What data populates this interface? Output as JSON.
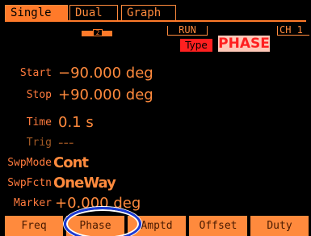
{
  "tabs": {
    "single": "Single",
    "dual": "Dual",
    "graph": "Graph"
  },
  "status": {
    "channel_indicator": "2",
    "run": "RUN",
    "channel": "CH 1",
    "type_label": "Type",
    "type_value": "PHASE"
  },
  "params": {
    "start": {
      "label": "Start",
      "value": "−90.000 deg"
    },
    "stop": {
      "label": "Stop",
      "value": "+90.000 deg"
    },
    "time": {
      "label": "Time",
      "value": "0.1 s"
    },
    "trig": {
      "label": "Trig",
      "value": "---"
    },
    "swpmode": {
      "label": "SwpMode",
      "value": "Cont"
    },
    "swpfctn": {
      "label": "SwpFctn",
      "value": "OneWay"
    },
    "marker": {
      "label": "Marker",
      "value": "+0.000 deg"
    }
  },
  "softkeys": {
    "freq": "Freq",
    "phase": "Phase",
    "amptd": "Amptd",
    "offset": "Offset",
    "duty": "Duty"
  },
  "colors": {
    "background": "#000000",
    "accent": "#ff8a3d",
    "alert": "#ff2020",
    "highlight_ring": "#1a3ad6"
  }
}
